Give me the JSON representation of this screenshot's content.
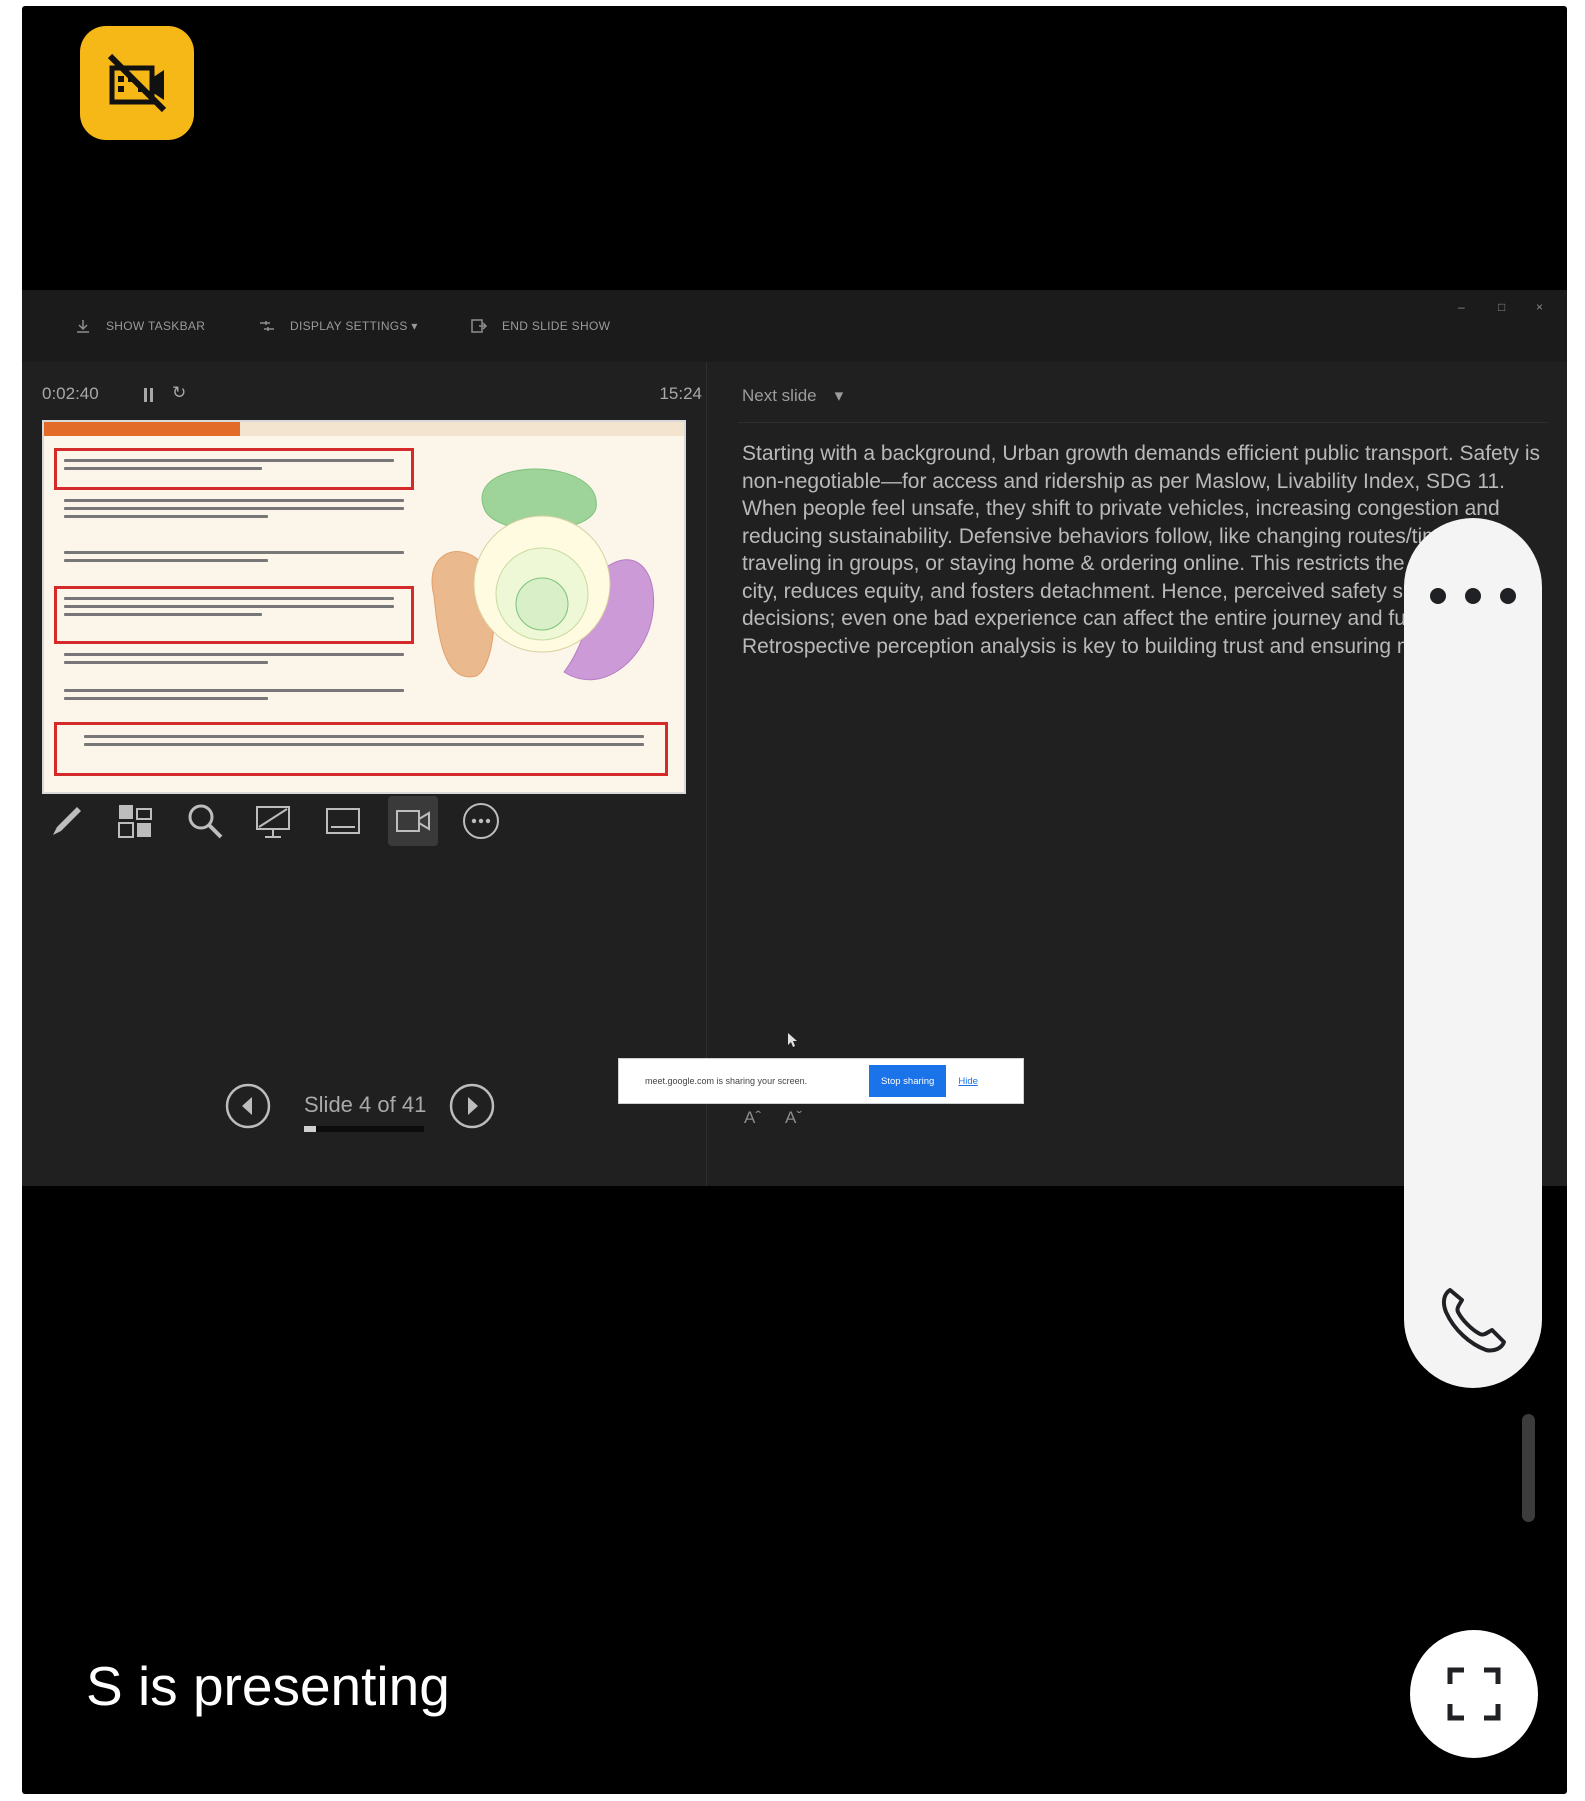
{
  "meeting": {
    "presenter_status": "S is presenting"
  },
  "presenter_view": {
    "toolbar": {
      "show_taskbar": "SHOW TASKBAR",
      "display_settings": "DISPLAY SETTINGS ▾",
      "end_slide_show": "END SLIDE SHOW"
    },
    "window_controls": {
      "minimize": "–",
      "restore": "□",
      "close": "×"
    },
    "timer": "0:02:40",
    "clock": "15:24",
    "slide_counter": "Slide 4 of 41",
    "progress_fraction": 0.1,
    "next_slide_label": "Next slide",
    "next_slide_dropdown": "▾",
    "notes": "Starting with a background, Urban growth demands efficient public transport. Safety is non-negotiable—for access and ridership as per Maslow, Livability Index, SDG 11. When people feel unsafe, they shift to private vehicles, increasing congestion and reducing sustainability. Defensive behaviors follow, like changing routes/times, traveling in groups, or staying home & ordering online. This restricts the right to the city, reduces equity, and fosters detachment. Hence, perceived safety shapes travel decisions; even one bad experience can affect the entire journey and future use. Retrospective perception analysis is key to building trust and ensuring mobility equity.",
    "font_size_controls": {
      "increase": "Aˆ",
      "decrease": "Aˇ"
    }
  },
  "screen_share_bar": {
    "message": "meet.google.com is sharing your screen.",
    "stop_label": "Stop sharing",
    "hide_label": "Hide"
  },
  "colors": {
    "camera_off_badge": "#f6b817",
    "share_stop_button": "#1a73e8",
    "slide_highlight_border": "#d42a2a",
    "diagram_green": "#7cc27a",
    "diagram_orange": "#e3a06a",
    "diagram_purple": "#b57cc4"
  },
  "icons": {
    "camera_off": "camera-off-icon",
    "pen": "pen-icon",
    "see_all_slides": "see-all-slides-icon",
    "zoom": "zoom-icon",
    "black_screen": "black-screen-icon",
    "subtitles": "subtitles-icon",
    "camera_toggle": "video-camera-icon",
    "more_options": "more-options-icon",
    "phone": "phone-icon",
    "fullscreen": "fullscreen-icon"
  }
}
